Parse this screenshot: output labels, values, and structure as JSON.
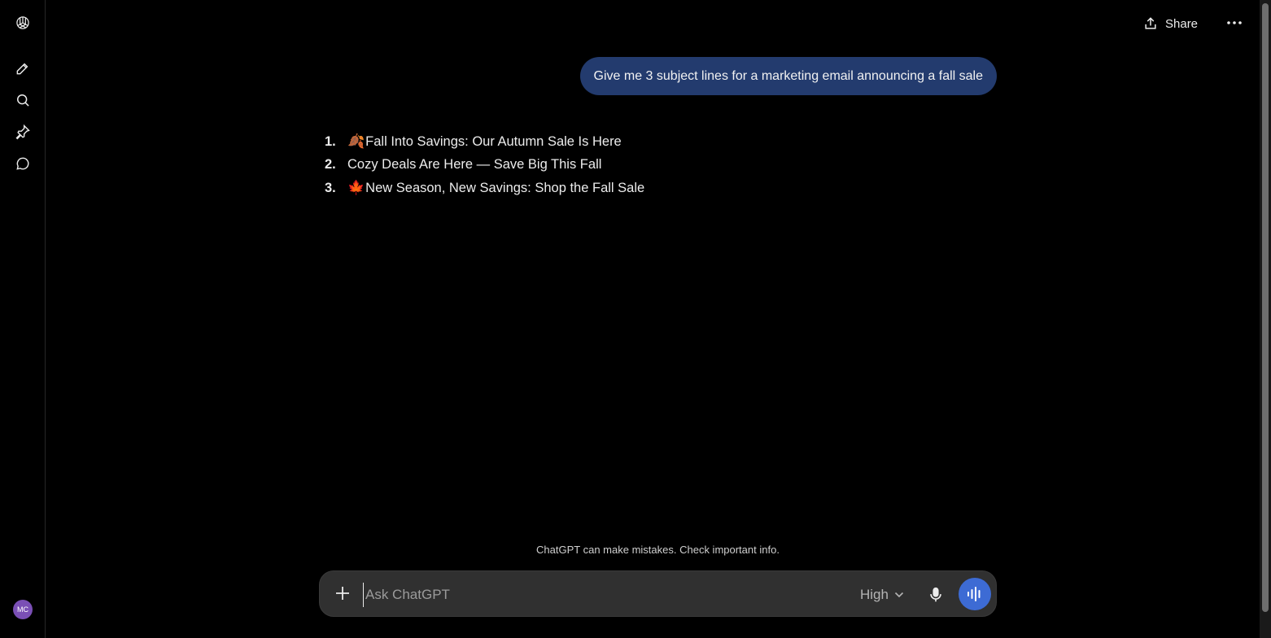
{
  "sidebar": {
    "logo_icon": "openai-logo-icon",
    "items": [
      {
        "name": "new-chat",
        "icon": "edit-icon"
      },
      {
        "name": "search",
        "icon": "search-icon"
      },
      {
        "name": "pin",
        "icon": "pin-icon"
      },
      {
        "name": "chats",
        "icon": "chat-bubble-icon"
      }
    ],
    "avatar_initials": "MC",
    "avatar_color": "#7a4fb5"
  },
  "header": {
    "share_label": "Share",
    "more_icon": "ellipsis-icon"
  },
  "conversation": {
    "user_message": "Give me 3 subject lines for a marketing email announcing a fall sale",
    "assistant_list": [
      {
        "num": "1.",
        "emoji": "🍂",
        "text": "Fall Into Savings: Our Autumn Sale Is Here"
      },
      {
        "num": "2.",
        "emoji": "",
        "text": "Cozy Deals Are Here — Save Big This Fall"
      },
      {
        "num": "3.",
        "emoji": "🍁",
        "text": "New Season, New Savings: Shop the Fall Sale"
      }
    ]
  },
  "disclaimer": "ChatGPT can make mistakes. Check important info.",
  "composer": {
    "placeholder": "Ask ChatGPT",
    "value": "",
    "model_label": "High",
    "accent_color": "#3d6bd4"
  },
  "colors": {
    "background": "#000000",
    "user_bubble": "#233b6e",
    "composer_bg": "#303030"
  }
}
